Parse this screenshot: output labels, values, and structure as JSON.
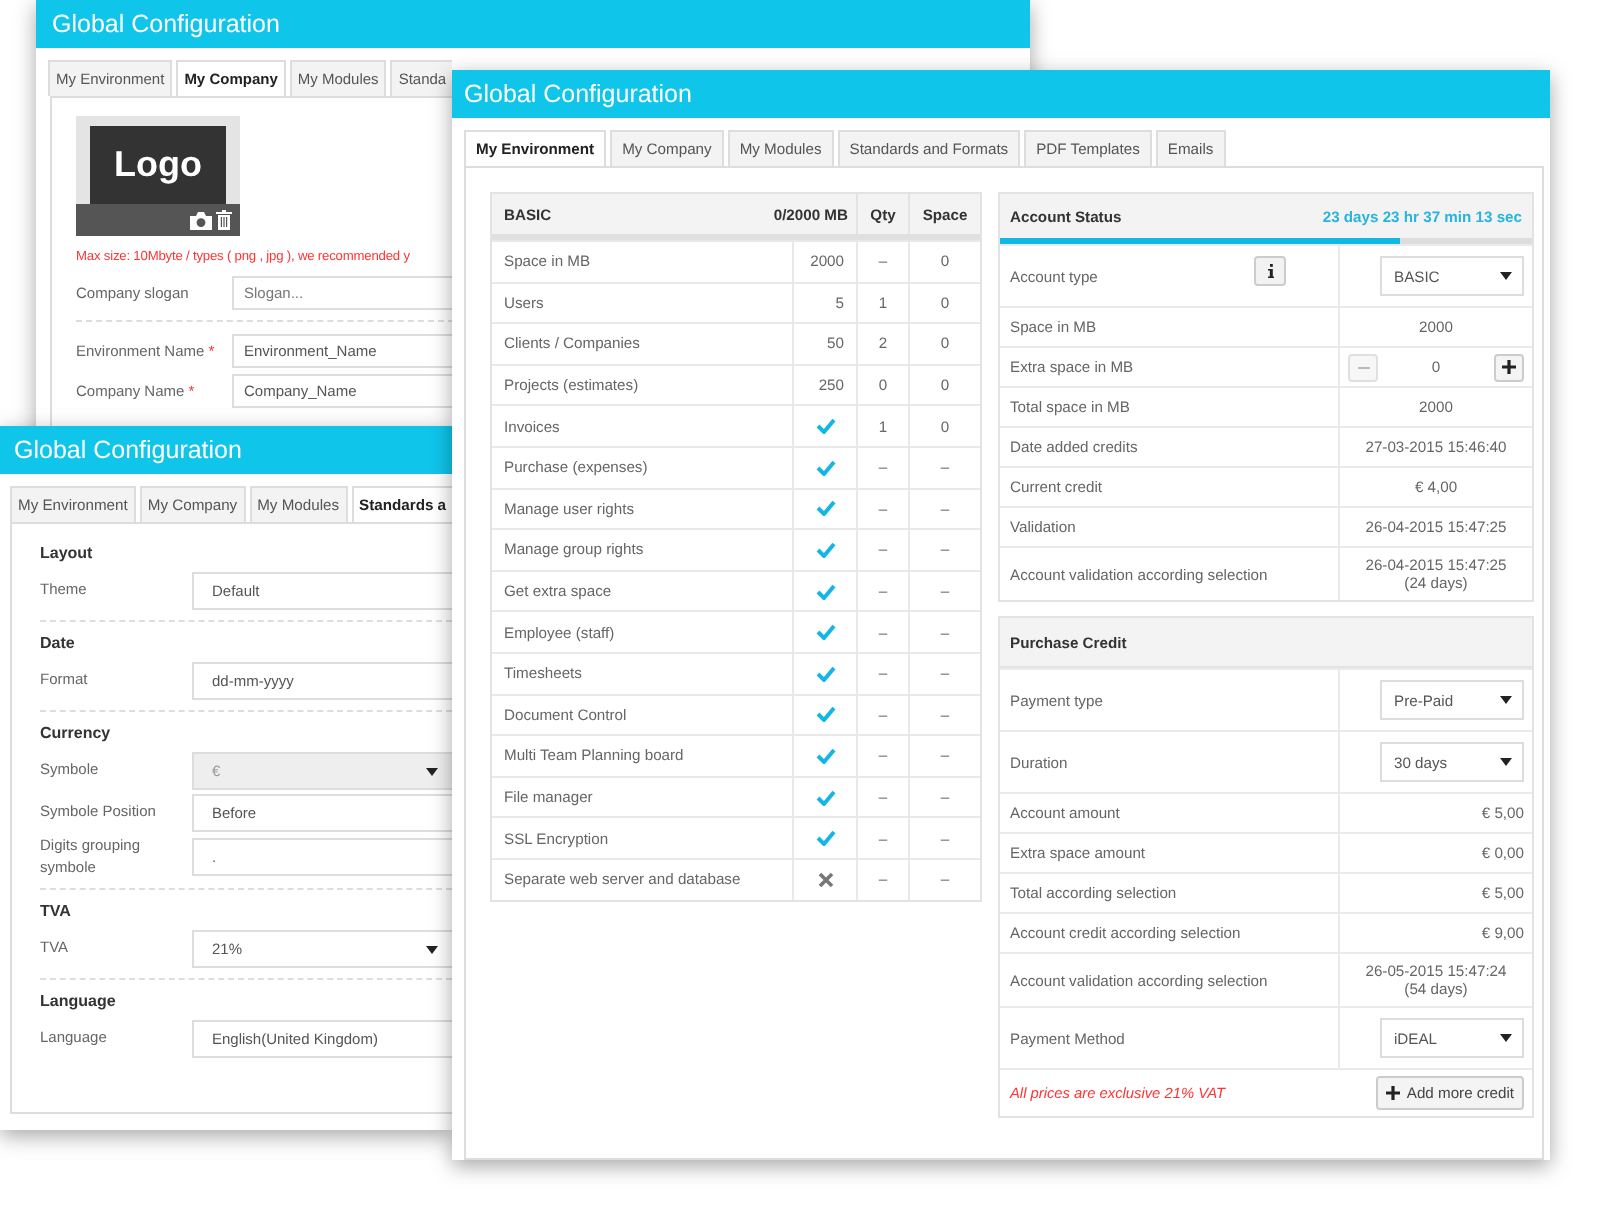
{
  "windows": [
    {
      "kind": "company",
      "title": "Global Configuration",
      "tabs": [
        {
          "label": "My Environment",
          "selected": false
        },
        {
          "label": "My Company",
          "selected": true
        },
        {
          "label": "My Modules",
          "selected": false
        },
        {
          "label": "Standa",
          "selected": false
        }
      ],
      "logo_text": "Logo",
      "upload_hint": "Max size: 10Mbyte / types ( png , jpg ), we recommended y",
      "field_groups": [
        [
          {
            "label": "Company slogan",
            "placeholder": "Slogan..."
          }
        ],
        [
          {
            "label": "Environment Name",
            "required_mark": "*",
            "value": "Environment_Name"
          },
          {
            "label": "Company Name",
            "required_mark": "*",
            "value": "Company_Name"
          }
        ]
      ]
    },
    {
      "kind": "standards",
      "title": "Global Configuration",
      "tabs": [
        {
          "label": "My Environment",
          "selected": false
        },
        {
          "label": "My Company",
          "selected": false
        },
        {
          "label": "My Modules",
          "selected": false
        },
        {
          "label": "Standards a",
          "selected": true
        }
      ],
      "sections": [
        {
          "heading": "Layout",
          "rows": [
            {
              "label": "Theme",
              "kind": "text",
              "value": "Default",
              "disabled": false
            }
          ]
        },
        {
          "heading": "Date",
          "rows": [
            {
              "label": "Format",
              "kind": "text",
              "value": "dd-mm-yyyy",
              "disabled": false
            }
          ]
        },
        {
          "heading": "Currency",
          "rows": [
            {
              "label": "Symbole",
              "kind": "select",
              "value": "€",
              "disabled": true
            },
            {
              "label": "Symbole Position",
              "kind": "text",
              "value": "Before",
              "disabled": false
            },
            {
              "label": "Digits grouping symbole",
              "kind": "text",
              "value": ".",
              "disabled": false
            }
          ]
        },
        {
          "heading": "TVA",
          "rows": [
            {
              "label": "TVA",
              "kind": "select",
              "value": "21%",
              "disabled": false
            }
          ]
        },
        {
          "heading": "Language",
          "rows": [
            {
              "label": "Language",
              "kind": "text",
              "value": "English(United Kingdom)",
              "disabled": false
            }
          ]
        }
      ]
    },
    {
      "kind": "environment",
      "title": "Global Configuration",
      "tabs": [
        {
          "label": "My Environment",
          "selected": true
        },
        {
          "label": "My Company",
          "selected": false
        },
        {
          "label": "My Modules",
          "selected": false
        },
        {
          "label": "Standards and Formats",
          "selected": false
        },
        {
          "label": "PDF Templates",
          "selected": false
        },
        {
          "label": "Emails",
          "selected": false
        }
      ],
      "modules_table": {
        "columns": [
          "BASIC",
          "0/2000 MB",
          "Qty",
          "Space"
        ],
        "rows": [
          {
            "name": "Space in MB",
            "kind": "number",
            "value": "2000",
            "qty": "–",
            "space": "0"
          },
          {
            "name": "Users",
            "kind": "number",
            "value": "5",
            "qty": "1",
            "space": "0"
          },
          {
            "name": "Clients / Companies",
            "kind": "number",
            "value": "50",
            "qty": "2",
            "space": "0"
          },
          {
            "name": "Projects (estimates)",
            "kind": "number",
            "value": "250",
            "qty": "0",
            "space": "0"
          },
          {
            "name": "Invoices",
            "kind": "feature",
            "included": true,
            "qty": "1",
            "space": "0"
          },
          {
            "name": "Purchase (expenses)",
            "kind": "feature",
            "included": true,
            "qty": "–",
            "space": "–"
          },
          {
            "name": "Manage user rights",
            "kind": "feature",
            "included": true,
            "qty": "–",
            "space": "–"
          },
          {
            "name": "Manage group rights",
            "kind": "feature",
            "included": true,
            "qty": "–",
            "space": "–"
          },
          {
            "name": "Get extra space",
            "kind": "feature",
            "included": true,
            "qty": "–",
            "space": "–"
          },
          {
            "name": "Employee (staff)",
            "kind": "feature",
            "included": true,
            "qty": "–",
            "space": "–"
          },
          {
            "name": "Timesheets",
            "kind": "feature",
            "included": true,
            "qty": "–",
            "space": "–"
          },
          {
            "name": "Document Control",
            "kind": "feature",
            "included": true,
            "qty": "–",
            "space": "–"
          },
          {
            "name": "Multi Team Planning board",
            "kind": "feature",
            "included": true,
            "qty": "–",
            "space": "–"
          },
          {
            "name": "File manager",
            "kind": "feature",
            "included": true,
            "qty": "–",
            "space": "–"
          },
          {
            "name": "SSL Encryption",
            "kind": "feature",
            "included": true,
            "qty": "–",
            "space": "–"
          },
          {
            "name": "Separate web server and database",
            "kind": "feature",
            "included": false,
            "qty": "–",
            "space": "–"
          }
        ]
      },
      "account_status": {
        "title": "Account Status",
        "countdown": "23 days 23 hr 37 min 13 sec",
        "level": 0.75,
        "rows": [
          {
            "label": "Account type",
            "kind": "select",
            "value": "BASIC",
            "info_button": true
          },
          {
            "label": "Space in MB",
            "kind": "text",
            "value": "2000"
          },
          {
            "label": "Extra space in MB",
            "kind": "stepper",
            "value": "0",
            "decrease_disabled": true
          },
          {
            "label": "Total space in MB",
            "kind": "text",
            "value": "2000"
          },
          {
            "label": "Date added credits",
            "kind": "text",
            "value": "27-03-2015 15:46:40"
          },
          {
            "label": "Current credit",
            "kind": "text",
            "value": "€ 4,00"
          },
          {
            "label": "Validation",
            "kind": "text",
            "value": "26-04-2015 15:47:25"
          },
          {
            "label": "Account validation according selection",
            "kind": "text",
            "value": "26-04-2015 15:47:25",
            "note": "(24 days)"
          }
        ]
      },
      "purchase_credit": {
        "title": "Purchase Credit",
        "rows": [
          {
            "label": "Payment type",
            "kind": "select",
            "value": "Pre-Paid"
          },
          {
            "label": "Duration",
            "kind": "select",
            "value": "30 days"
          },
          {
            "label": "Account amount",
            "kind": "amount",
            "value": "€ 5,00"
          },
          {
            "label": "Extra space amount",
            "kind": "amount",
            "value": "€ 0,00"
          },
          {
            "label": "Total according selection",
            "kind": "amount",
            "value": "€ 5,00"
          },
          {
            "label": "Account credit according selection",
            "kind": "amount",
            "value": "€ 9,00"
          },
          {
            "label": "Account validation according selection",
            "kind": "text",
            "value": "26-05-2015 15:47:24",
            "note": "(54 days)"
          },
          {
            "label": "Payment Method",
            "kind": "select",
            "value": "iDEAL"
          }
        ],
        "vat_note": "All prices are exclusive 21% VAT",
        "add_button": "Add more credit"
      }
    }
  ]
}
